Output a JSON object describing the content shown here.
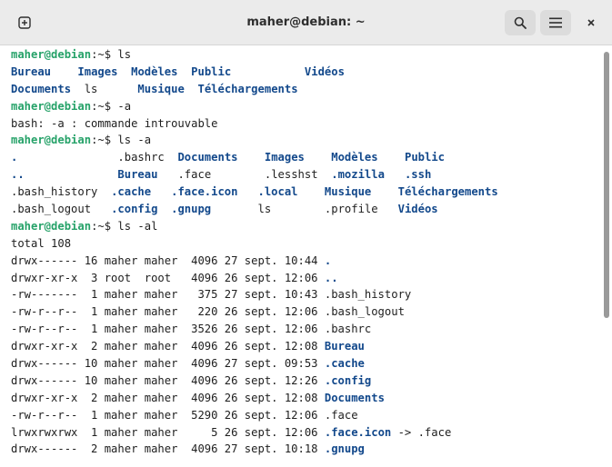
{
  "window": {
    "title": "maher@debian: ~",
    "icons": {
      "new_tab": "new-tab-icon",
      "search": "search-icon",
      "menu": "hamburger-menu-icon",
      "close": "close-icon"
    }
  },
  "colors": {
    "prompt": "#26a269",
    "directory": "#12488b",
    "text": "#1e1e1e",
    "titlebar": "#ebebeb"
  },
  "terminal": {
    "lines": [
      [
        {
          "t": "maher@debian",
          "c": "prompt"
        },
        {
          "t": ":~$ ls"
        }
      ],
      [
        {
          "t": "Bureau",
          "c": "dir"
        },
        {
          "t": "    "
        },
        {
          "t": "Images",
          "c": "dir"
        },
        {
          "t": "  "
        },
        {
          "t": "Modèles",
          "c": "dir"
        },
        {
          "t": "  "
        },
        {
          "t": "Public",
          "c": "dir"
        },
        {
          "t": "           "
        },
        {
          "t": "Vidéos",
          "c": "dir"
        }
      ],
      [
        {
          "t": "Documents",
          "c": "dir"
        },
        {
          "t": "  ls      "
        },
        {
          "t": "Musique",
          "c": "dir"
        },
        {
          "t": "  "
        },
        {
          "t": "Téléchargements",
          "c": "dir"
        }
      ],
      [
        {
          "t": "maher@debian",
          "c": "prompt"
        },
        {
          "t": ":~$ -a"
        }
      ],
      [
        {
          "t": "bash: -a : commande introuvable"
        }
      ],
      [
        {
          "t": "maher@debian",
          "c": "prompt"
        },
        {
          "t": ":~$ ls -a"
        }
      ],
      [
        {
          "t": ".",
          "c": "dir"
        },
        {
          "t": "               .bashrc  "
        },
        {
          "t": "Documents",
          "c": "dir"
        },
        {
          "t": "    "
        },
        {
          "t": "Images",
          "c": "dir"
        },
        {
          "t": "    "
        },
        {
          "t": "Modèles",
          "c": "dir"
        },
        {
          "t": "    "
        },
        {
          "t": "Public",
          "c": "dir"
        }
      ],
      [
        {
          "t": "..",
          "c": "dir"
        },
        {
          "t": "              "
        },
        {
          "t": "Bureau",
          "c": "dir"
        },
        {
          "t": "   .face        .lesshst  "
        },
        {
          "t": ".mozilla",
          "c": "dir"
        },
        {
          "t": "   "
        },
        {
          "t": ".ssh",
          "c": "dir"
        }
      ],
      [
        {
          "t": ".bash_history  "
        },
        {
          "t": ".cache",
          "c": "dir"
        },
        {
          "t": "   "
        },
        {
          "t": ".face.icon",
          "c": "dir"
        },
        {
          "t": "   "
        },
        {
          "t": ".local",
          "c": "dir"
        },
        {
          "t": "    "
        },
        {
          "t": "Musique",
          "c": "dir"
        },
        {
          "t": "    "
        },
        {
          "t": "Téléchargements",
          "c": "dir"
        }
      ],
      [
        {
          "t": ".bash_logout   "
        },
        {
          "t": ".config",
          "c": "dir"
        },
        {
          "t": "  "
        },
        {
          "t": ".gnupg",
          "c": "dir"
        },
        {
          "t": "       ls        .profile   "
        },
        {
          "t": "Vidéos",
          "c": "dir"
        }
      ],
      [
        {
          "t": "maher@debian",
          "c": "prompt"
        },
        {
          "t": ":~$ ls -al"
        }
      ],
      [
        {
          "t": "total 108"
        }
      ],
      [
        {
          "t": "drwx------ 16 maher maher  4096 27 sept. 10:44 "
        },
        {
          "t": ".",
          "c": "dir"
        }
      ],
      [
        {
          "t": "drwxr-xr-x  3 root  root   4096 26 sept. 12:06 "
        },
        {
          "t": "..",
          "c": "dir"
        }
      ],
      [
        {
          "t": "-rw-------  1 maher maher   375 27 sept. 10:43 .bash_history"
        }
      ],
      [
        {
          "t": "-rw-r--r--  1 maher maher   220 26 sept. 12:06 .bash_logout"
        }
      ],
      [
        {
          "t": "-rw-r--r--  1 maher maher  3526 26 sept. 12:06 .bashrc"
        }
      ],
      [
        {
          "t": "drwxr-xr-x  2 maher maher  4096 26 sept. 12:08 "
        },
        {
          "t": "Bureau",
          "c": "dir"
        }
      ],
      [
        {
          "t": "drwx------ 10 maher maher  4096 27 sept. 09:53 "
        },
        {
          "t": ".cache",
          "c": "dir"
        }
      ],
      [
        {
          "t": "drwx------ 10 maher maher  4096 26 sept. 12:26 "
        },
        {
          "t": ".config",
          "c": "dir"
        }
      ],
      [
        {
          "t": "drwxr-xr-x  2 maher maher  4096 26 sept. 12:08 "
        },
        {
          "t": "Documents",
          "c": "dir"
        }
      ],
      [
        {
          "t": "-rw-r--r--  1 maher maher  5290 26 sept. 12:06 .face"
        }
      ],
      [
        {
          "t": "lrwxrwxrwx  1 maher maher     5 26 sept. 12:06 "
        },
        {
          "t": ".face.icon",
          "c": "dir"
        },
        {
          "t": " -> .face"
        }
      ],
      [
        {
          "t": "drwx------  2 maher maher  4096 27 sept. 10:18 "
        },
        {
          "t": ".gnupg",
          "c": "dir"
        }
      ]
    ]
  }
}
